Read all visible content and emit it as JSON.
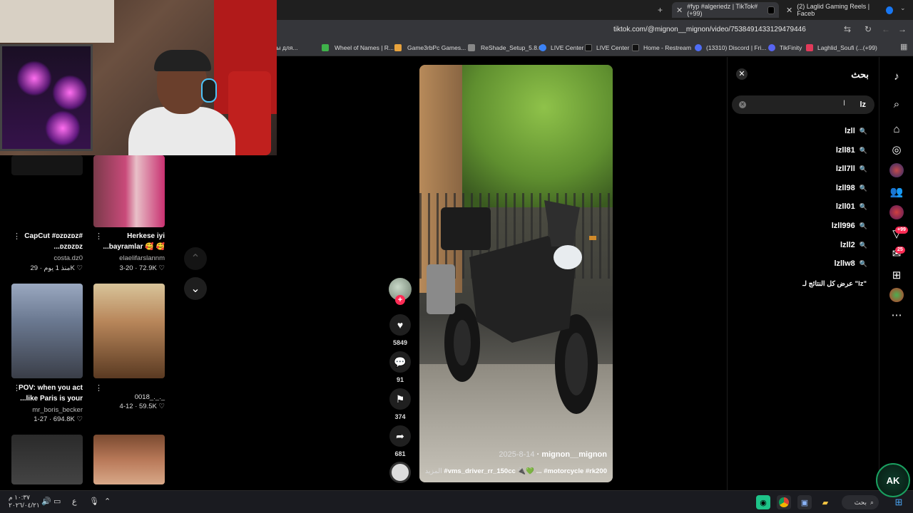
{
  "tabs": [
    {
      "label": "#fyp #algeriedz | TikTok#(+99)",
      "active": true
    },
    {
      "label": "(2) Laglid Gaming Reels | Faceb"
    }
  ],
  "toolbar": {
    "url": "tiktok.com/@mignon__mignon/video/7538491433129479446"
  },
  "bookmarks": [
    "ـ игры для...",
    "Wheel of Names | R...",
    "Game3rbPc Games...",
    "ReShade_Setup_5.8.0",
    "LIVE Center",
    "LIVE Center",
    "Home - Restream",
    "(13310) Discord | Fri...",
    "TikFinity",
    "Laghlid_Soufi (...(+99)"
  ],
  "feed": {
    "items": [
      {
        "caption": "CapCut #ᴅᴢᴅᴢᴅᴢ#",
        "caption2": "...ᴅᴢᴅᴢᴅᴢ",
        "author": "costa.dz0",
        "meta": "منذ 1 يوم · 29K ♡"
      },
      {
        "caption": "Herkese iyi",
        "caption2": "...bayramlar 🥰 🥰",
        "author": "elaelifarslannm",
        "meta": "3-20 · 72.9K ♡"
      },
      {
        "caption": "POV: when you act",
        "caption2": "...like Paris is your",
        "author": "mr_boris_becker",
        "meta": "1-27 · 694.8K ♡"
      },
      {
        "caption": "",
        "caption2": "",
        "author": "0018_._._",
        "meta": "4-12 · 59.5K ♡"
      }
    ]
  },
  "video": {
    "author": "mignon__mignon",
    "date": "2025-8-14",
    "caption": "#vms_driver_rr_150cc 🔌💚 ...",
    "caption_tags": "#motorcycle #rk200",
    "more_label": "المزيد"
  },
  "actions": {
    "likes": "5849",
    "comments": "91",
    "saves": "374",
    "shares": "681"
  },
  "search": {
    "title": "بحث",
    "query": "lz",
    "suggestions": [
      "lzll",
      "lzll81",
      "lzll7ll",
      "lzll98",
      "lzll01",
      "lzll996",
      "lzll2",
      "lzllw8"
    ],
    "see_all": "عرض كل النتائج لـ \"lz\""
  },
  "rail": {
    "badge_activity": "+99",
    "badge_messages": "25"
  },
  "taskbar": {
    "time": "١٠:٣٧ م",
    "date": "٢٠٢٦/٠٤/٢١",
    "lang": "ع",
    "search_label": "بحث"
  },
  "logo_text": "AK"
}
